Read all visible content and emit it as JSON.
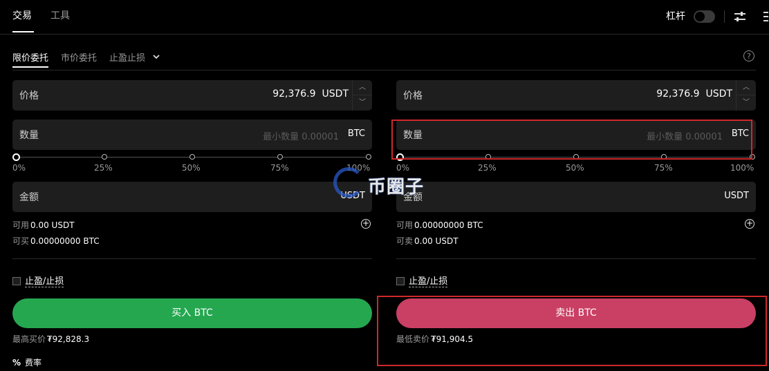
{
  "top_tabs": {
    "trade": "交易",
    "tools": "工具"
  },
  "leverage_label": "杠杆",
  "order_types": {
    "limit": "限价委托",
    "market": "市价委托",
    "tpsl": "止盈止损"
  },
  "help_glyph": "?",
  "buy": {
    "price_label": "价格",
    "price_value": "92,376.9",
    "price_unit": "USDT",
    "qty_label": "数量",
    "qty_placeholder": "最小数量 0.00001",
    "qty_unit": "BTC",
    "slider_labels": [
      "0%",
      "25%",
      "50%",
      "75%",
      "100%"
    ],
    "amount_label": "金额",
    "amount_unit": "USDT",
    "avail_label": "可用",
    "avail_value": "0.00 USDT",
    "can_label": "可买",
    "can_value": "0.00000000 BTC",
    "tpsl_label": "止盈/止损",
    "button_label": "买入 BTC",
    "best_label": "最高买价",
    "best_value": "₮92,828.3"
  },
  "sell": {
    "price_label": "价格",
    "price_value": "92,376.9",
    "price_unit": "USDT",
    "qty_label": "数量",
    "qty_placeholder": "最小数量 0.00001",
    "qty_unit": "BTC",
    "slider_labels": [
      "0%",
      "25%",
      "50%",
      "75%",
      "100%"
    ],
    "amount_label": "金额",
    "amount_unit": "USDT",
    "avail_label": "可用",
    "avail_value": "0.00000000 BTC",
    "can_label": "可卖",
    "can_value": "0.00 USDT",
    "tpsl_label": "止盈/止损",
    "button_label": "卖出 BTC",
    "best_label": "最低卖价",
    "best_value": "₮91,904.5"
  },
  "fee": {
    "icon": "%",
    "label": "费率"
  },
  "watermark_text": "币圈子",
  "colors": {
    "buy": "#25a750",
    "sell": "#ca3f64",
    "highlight": "#d0282a"
  }
}
